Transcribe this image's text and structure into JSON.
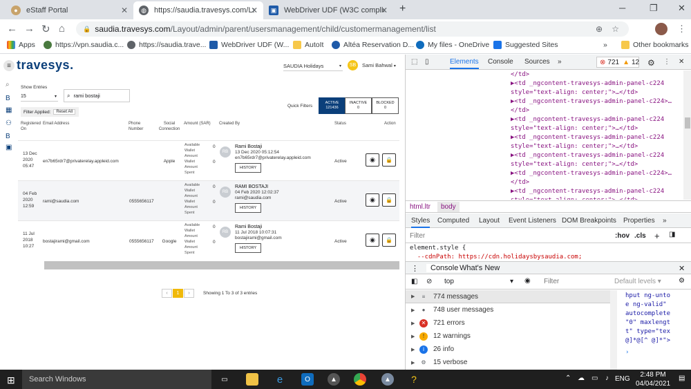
{
  "browser": {
    "tabs": [
      {
        "title": "eStaff Portal",
        "active": false
      },
      {
        "title": "https://saudia.travesys.com/Layo",
        "active": true
      },
      {
        "title": "WebDriver UDF (W3C compliant",
        "active": false
      }
    ],
    "url_host": "saudia.travesys.com",
    "url_path": "/Layout/admin/parent/usersmanagement/child/customermanagement/list",
    "bookmarks": [
      "Apps",
      "https://vpn.saudia.c...",
      "https://saudia.trave...",
      "WebDriver UDF (W...",
      "AutoIt",
      "Altéa Reservation D...",
      "My files - OneDrive",
      "Suggested Sites"
    ],
    "other_bookmarks": "Other bookmarks",
    "more": "»"
  },
  "app": {
    "logo": "travesys.",
    "org_select": "SAUDIA Holidays",
    "user_initials": "SB",
    "user_name": "Sami Bahwal",
    "show_entries_label": "Show Entries",
    "show_entries_value": "15",
    "search_value": "rami bostaji",
    "filter_applied_label": "Filter Applied:",
    "reset_all": "Reset All",
    "quick_filters_label": "Quick Filters",
    "quick_filters": [
      {
        "label": "ACTIVE",
        "count": "121436"
      },
      {
        "label": "INACTIVE",
        "count": "0"
      },
      {
        "label": "BLOCKED",
        "count": "0"
      }
    ],
    "columns": [
      "Registered On",
      "Email Address",
      "Phone Number",
      "Social Connection",
      "Amount (SAR)",
      "Created By",
      "Status",
      "Action"
    ],
    "rows": [
      {
        "registered": [
          "13 Dec",
          "2020",
          "05:47"
        ],
        "email": "en7b65rdr7@privaterelay.appleid.com",
        "phone": "",
        "social": "Apple",
        "amounts": [
          "Available",
          "Wallet",
          "Amount",
          "Wallet",
          "Amount",
          "Spent"
        ],
        "amount_values": [
          "0",
          "0"
        ],
        "initials": "RB",
        "creator_name": "Rami Bostaji",
        "creator_date": "13 Dec 2020 05:12:54",
        "creator_email": "en7b65rdr7@privaterelay.appleid.com",
        "history": "HISTORY",
        "status": "Active"
      },
      {
        "registered": [
          "04 Feb",
          "2020",
          "12:59"
        ],
        "email": "rami@saudia.com",
        "phone": "0555656117",
        "social": "",
        "amounts": [
          "Available",
          "Wallet",
          "Amount",
          "Wallet",
          "Amount",
          "Spent"
        ],
        "amount_values": [
          "0",
          "0"
        ],
        "initials": "RB",
        "creator_name": "RAMI BOSTAJI",
        "creator_date": "04 Feb 2020 12:02:37",
        "creator_email": "rami@saudia.com",
        "history": "HISTORY",
        "status": "Active"
      },
      {
        "registered": [
          "11 Jul",
          "2018",
          "10:27"
        ],
        "email": "bostajirami@gmail.com",
        "phone": "0555656117",
        "social": "Google",
        "amounts": [
          "Available",
          "Wallet",
          "Amount",
          "Wallet",
          "Amount",
          "Spent"
        ],
        "amount_values": [
          "0",
          "0"
        ],
        "initials": "RB",
        "creator_name": "Rami Bostaji",
        "creator_date": "11 Jul 2018 10:07:31",
        "creator_email": "bostajirami@gmail.com",
        "history": "HISTORY",
        "status": "Active"
      }
    ],
    "pager_current": "1",
    "pager_prev": "‹",
    "pager_next": "›",
    "showing": "Showing 1 To 3 of 3 entries"
  },
  "devtools": {
    "tabs": [
      "Elements",
      "Console",
      "Sources"
    ],
    "more": "»",
    "errors": "721",
    "warnings": "12",
    "dom_lines": [
      "</td>",
      "▶<td _ngcontent-travesys-admin-panel-c224",
      "style=\"text-align: center;\">…</td>",
      "▶<td _ngcontent-travesys-admin-panel-c224>…",
      "</td>",
      "▶<td _ngcontent-travesys-admin-panel-c224",
      "style=\"text-align: center;\">…</td>",
      "▶<td _ngcontent-travesys-admin-panel-c224",
      "style=\"text-align: center;\">…</td>",
      "▶<td _ngcontent-travesys-admin-panel-c224",
      "style=\"text-align: center;\">…</td>",
      "▶<td _ngcontent-travesys-admin-panel-c224>…",
      "</td>",
      "▶<td _ngcontent-travesys-admin-panel-c224",
      "style=\"text-align: center;\">…</td>"
    ],
    "crumbs": [
      "html.ltr",
      "body"
    ],
    "styles_tabs": [
      "Styles",
      "Computed",
      "Layout",
      "Event Listeners",
      "DOM Breakpoints",
      "Properties"
    ],
    "filter_placeholder": "Filter",
    "hov": ":hov",
    "cls": ".cls",
    "css_lines": [
      "element.style {",
      "  --cdnPath: https://cdn.holidaysbysaudia.com;"
    ],
    "drawer_tabs": [
      "Console",
      "What's New"
    ],
    "context": "top",
    "console_filter": "Filter",
    "default_levels": "Default levels ▾",
    "console_items": [
      {
        "label": "774 messages",
        "icon": "list-icon"
      },
      {
        "label": "748 user messages",
        "icon": "user-icon"
      },
      {
        "label": "721 errors",
        "icon": "error-icon"
      },
      {
        "label": "12 warnings",
        "icon": "warning-icon"
      },
      {
        "label": "26 info",
        "icon": "info-icon"
      },
      {
        "label": "15 verbose",
        "icon": "gear-icon"
      }
    ],
    "console_out": [
      "hput ng-unto",
      "e ng-valid\"",
      "autocomplete",
      "\"0\" maxlengt",
      "t\" type=\"tex",
      "@]*@[^ @]*\">"
    ],
    "prompt": "›"
  },
  "taskbar": {
    "search": "Search Windows",
    "lang": "ENG",
    "time": "2:48 PM",
    "date": "04/04/2021"
  }
}
